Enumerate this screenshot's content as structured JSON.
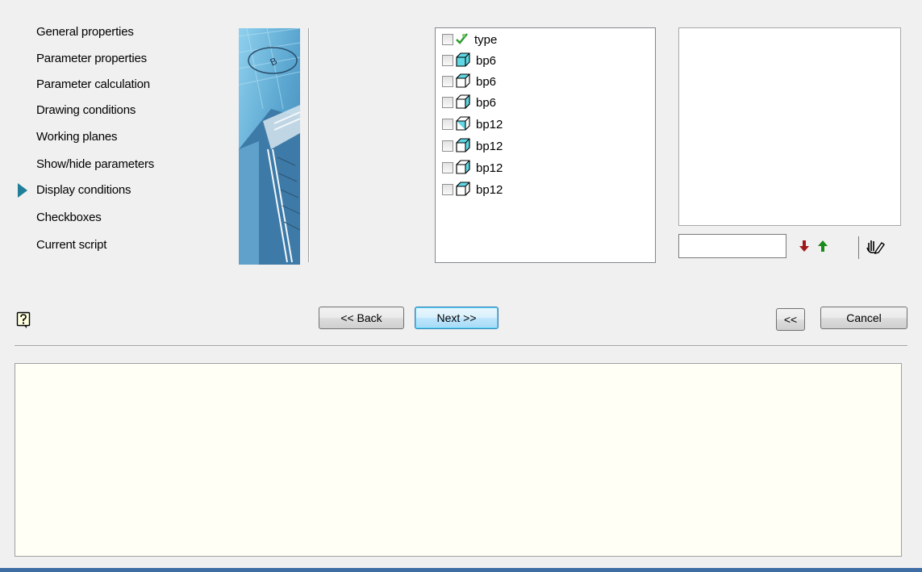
{
  "nav": {
    "items": [
      {
        "label": "General properties"
      },
      {
        "label": "Parameter properties"
      },
      {
        "label": "Parameter calculation"
      },
      {
        "label": "Drawing conditions"
      },
      {
        "label": "Working planes"
      },
      {
        "label": "Show/hide parameters"
      },
      {
        "label": "Display conditions",
        "active": true
      },
      {
        "label": "Checkboxes"
      },
      {
        "label": "Current script"
      }
    ]
  },
  "list": {
    "rows": [
      {
        "label": "type",
        "icon": "checkmark-icon",
        "checked": false
      },
      {
        "label": "bp6",
        "icon": "cube-icon",
        "checked": false
      },
      {
        "label": "bp6",
        "icon": "cube-icon",
        "checked": false
      },
      {
        "label": "bp6",
        "icon": "cube-icon",
        "checked": false
      },
      {
        "label": "bp12",
        "icon": "cube-icon",
        "checked": false
      },
      {
        "label": "bp12",
        "icon": "cube-icon",
        "checked": false
      },
      {
        "label": "bp12",
        "icon": "cube-icon",
        "checked": false
      },
      {
        "label": "bp12",
        "icon": "cube-icon",
        "checked": false
      }
    ]
  },
  "value_input": {
    "value": ""
  },
  "buttons": {
    "back": "<< Back",
    "next": "Next >>",
    "collapse": "<<",
    "cancel": "Cancel"
  },
  "colors": {
    "accent": "#1f7f98",
    "down_arrow": "#a01818",
    "up_arrow": "#1a8a1a",
    "info_bg": "#fffff6"
  }
}
